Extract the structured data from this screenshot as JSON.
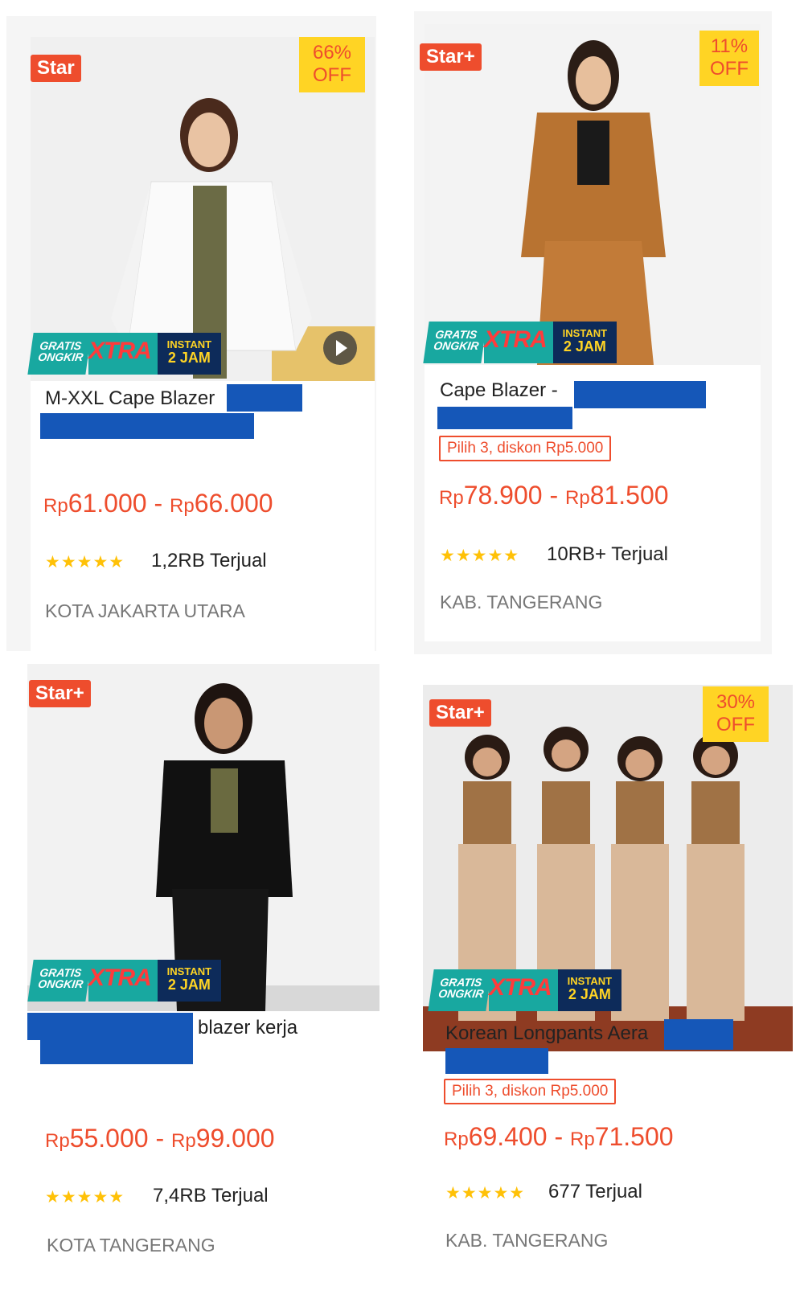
{
  "products": [
    {
      "star_badge": "Star",
      "discount": {
        "line1": "66%",
        "line2": "OFF"
      },
      "shipping": {
        "gratis": "GRATIS",
        "ongkir": "ONGKIR",
        "xtra": "XTRA",
        "instant": "INSTANT",
        "jam": "2 JAM"
      },
      "title": "M-XXL Cape Blazer",
      "price": {
        "cur1": "Rp",
        "min": "61.000",
        "sep": " - ",
        "cur2": "Rp",
        "max": "66.000"
      },
      "rating_stars": "★★★★★",
      "sold": "1,2RB Terjual",
      "location": "KOTA JAKARTA UTARA"
    },
    {
      "star_badge": "Star+",
      "discount": {
        "line1": "11%",
        "line2": "OFF"
      },
      "shipping": {
        "gratis": "GRATIS",
        "ongkir": "ONGKIR",
        "xtra": "XTRA",
        "instant": "INSTANT",
        "jam": "2 JAM"
      },
      "title": "Cape Blazer -",
      "promo": "Pilih 3, diskon Rp5.000",
      "price": {
        "cur1": "Rp",
        "min": "78.900",
        "sep": " - ",
        "cur2": "Rp",
        "max": "81.500"
      },
      "rating_stars": "★★★★★",
      "sold": "10RB+ Terjual",
      "location": "KAB. TANGERANG"
    },
    {
      "star_badge": "Star+",
      "shipping": {
        "gratis": "GRATIS",
        "ongkir": "ONGKIR",
        "xtra": "XTRA",
        "instant": "INSTANT",
        "jam": "2 JAM"
      },
      "title": "blazer kerja",
      "price": {
        "cur1": "Rp",
        "min": "55.000",
        "sep": " - ",
        "cur2": "Rp",
        "max": "99.000"
      },
      "rating_stars": "★★★★★",
      "sold": "7,4RB Terjual",
      "location": "KOTA TANGERANG"
    },
    {
      "star_badge": "Star+",
      "discount": {
        "line1": "30%",
        "line2": "OFF"
      },
      "shipping": {
        "gratis": "GRATIS",
        "ongkir": "ONGKIR",
        "xtra": "XTRA",
        "instant": "INSTANT",
        "jam": "2 JAM"
      },
      "title": "Korean Longpants Aera",
      "promo": "Pilih 3, diskon Rp5.000",
      "price": {
        "cur1": "Rp",
        "min": "69.400",
        "sep": " - ",
        "cur2": "Rp",
        "max": "71.500"
      },
      "rating_stars": "★★★★★",
      "sold": "677 Terjual",
      "location": "KAB. TANGERANG"
    }
  ],
  "colors": {
    "accent": "#ee4d2d",
    "discount_bg": "#ffd424",
    "redaction": "#1557b8",
    "ongkir_teal": "#18a8a0",
    "ongkir_navy": "#0d2b5a"
  }
}
